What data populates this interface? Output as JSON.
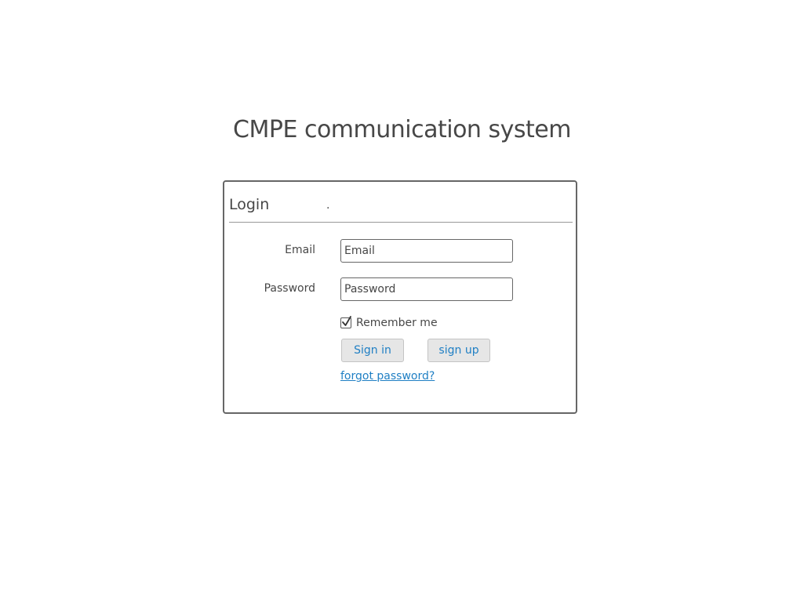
{
  "app": {
    "title": "CMPE communication system"
  },
  "login": {
    "header": "Login",
    "header_dot": ".",
    "email_label": "Email",
    "email_placeholder": "Email",
    "password_label": "Password",
    "password_placeholder": "Password",
    "remember_label": "Remember me",
    "remember_checked": true,
    "signin_label": "Sign in",
    "signup_label": "sign up",
    "forgot_label": "forgot password?"
  },
  "colors": {
    "text": "#474747",
    "link": "#1f7fc4",
    "button_bg": "#e6e6e6",
    "border": "#666666"
  }
}
